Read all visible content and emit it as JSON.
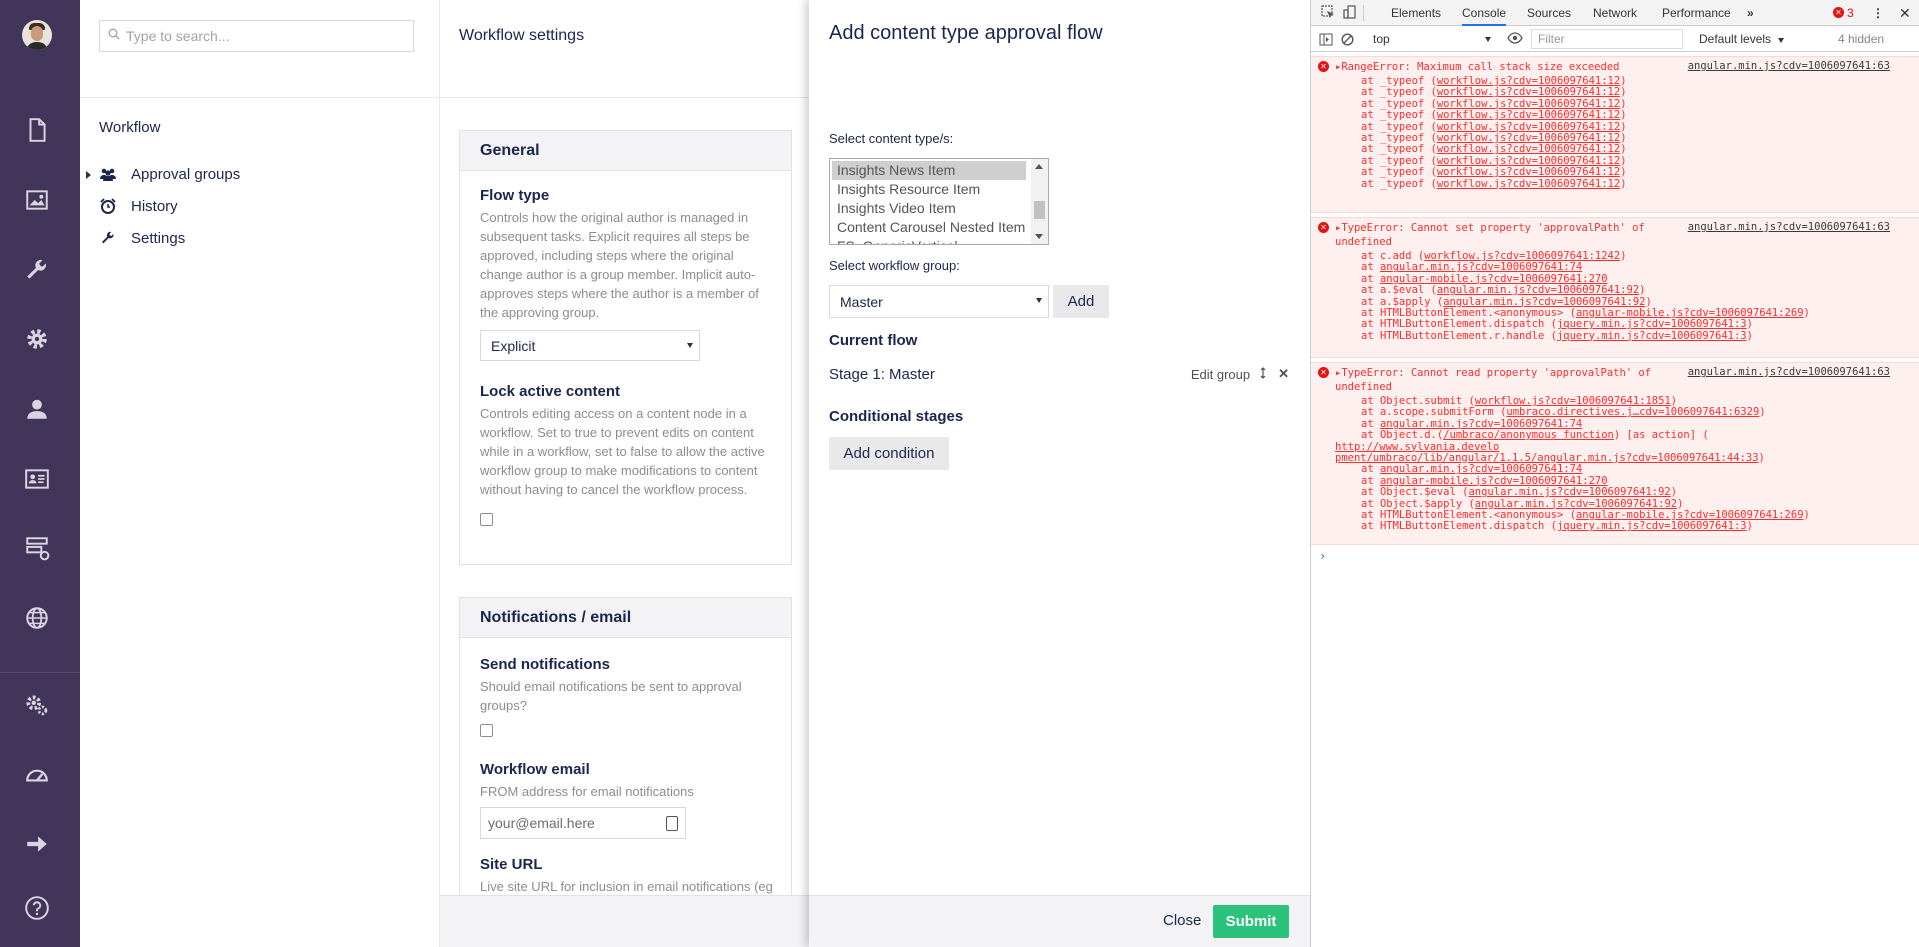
{
  "search": {
    "placeholder": "Type to search..."
  },
  "tree": {
    "title": "Workflow",
    "items": [
      {
        "label": "Approval groups",
        "icon": "users-icon"
      },
      {
        "label": "History",
        "icon": "alarm-clock-icon"
      },
      {
        "label": "Settings",
        "icon": "wrench-icon"
      }
    ]
  },
  "settings": {
    "title": "Workflow settings",
    "general": {
      "heading": "General",
      "flow_type_label": "Flow type",
      "flow_type_desc": "Controls how the original author is managed in subsequent tasks. Explicit requires all steps be approved, including steps where the original change author is a group member. Implicit auto-approves steps where the author is a member of the approving group.",
      "flow_type_value": "Explicit",
      "lock_label": "Lock active content",
      "lock_desc": "Controls editing access on a content node in a workflow. Set to true to prevent edits on content while in a workflow, set to false to allow the active workflow group to make modifications to content without having to cancel the workflow process."
    },
    "notifications": {
      "heading": "Notifications / email",
      "send_label": "Send notifications",
      "send_desc": "Should email notifications be sent to approval groups?",
      "email_label": "Workflow email",
      "email_desc": "FROM address for email notifications",
      "email_value": "your@email.here",
      "site_url_label": "Site URL",
      "site_url_desc": "Live site URL for inclusion in email notifications (eg"
    }
  },
  "dialog": {
    "title": "Add content type approval flow",
    "content_types_label": "Select content type/s:",
    "content_types": [
      "Insights News Item",
      "Insights Resource Item",
      "Insights Video Item",
      "Content Carousel Nested Item",
      "FS_GenericVertical"
    ],
    "workflow_group_label": "Select workflow group:",
    "workflow_group_value": "Master",
    "add_label": "Add",
    "current_flow_heading": "Current flow",
    "stage_label": "Stage 1: Master",
    "edit_group_label": "Edit group",
    "conditional_heading": "Conditional stages",
    "add_condition_label": "Add condition",
    "close_label": "Close",
    "submit_label": "Submit"
  },
  "devtools": {
    "tabs": [
      "Elements",
      "Console",
      "Sources",
      "Network",
      "Performance"
    ],
    "more_tabs": "»",
    "error_count": "3",
    "context": "top",
    "filter_placeholder": "Filter",
    "levels": "Default levels",
    "hidden": "4 hidden",
    "errors": [
      {
        "message": "RangeError: Maximum call stack size exceeded",
        "source": "angular.min.js?cdv=1006097641:63",
        "stack": [
          [
            "at _typeof (",
            "workflow.js?cdv=1006097641:12",
            ")"
          ],
          [
            "at _typeof (",
            "workflow.js?cdv=1006097641:12",
            ")"
          ],
          [
            "at _typeof (",
            "workflow.js?cdv=1006097641:12",
            ")"
          ],
          [
            "at _typeof (",
            "workflow.js?cdv=1006097641:12",
            ")"
          ],
          [
            "at _typeof (",
            "workflow.js?cdv=1006097641:12",
            ")"
          ],
          [
            "at _typeof (",
            "workflow.js?cdv=1006097641:12",
            ")"
          ],
          [
            "at _typeof (",
            "workflow.js?cdv=1006097641:12",
            ")"
          ],
          [
            "at _typeof (",
            "workflow.js?cdv=1006097641:12",
            ")"
          ],
          [
            "at _typeof (",
            "workflow.js?cdv=1006097641:12",
            ")"
          ],
          [
            "at _typeof (",
            "workflow.js?cdv=1006097641:12",
            ")"
          ]
        ]
      },
      {
        "message": "TypeError: Cannot set property 'approvalPath' of",
        "message2": "undefined",
        "source": "angular.min.js?cdv=1006097641:63",
        "stack": [
          [
            "at c.add (",
            "workflow.js?cdv=1006097641:1242",
            ")"
          ],
          [
            "at ",
            "angular.min.js?cdv=1006097641:74",
            ""
          ],
          [
            "at ",
            "angular-mobile.js?cdv=1006097641:270",
            ""
          ],
          [
            "at a.$eval (",
            "angular.min.js?cdv=1006097641:92",
            ")"
          ],
          [
            "at a.$apply (",
            "angular.min.js?cdv=1006097641:92",
            ")"
          ],
          [
            "at HTMLButtonElement.<anonymous> (",
            "angular-mobile.js?cdv=1006097641:269",
            ")"
          ],
          [
            "at HTMLButtonElement.dispatch (",
            "jquery.min.js?cdv=1006097641:3",
            ")"
          ],
          [
            "at HTMLButtonElement.r.handle (",
            "jquery.min.js?cdv=1006097641:3",
            ")"
          ]
        ]
      },
      {
        "message": "TypeError: Cannot read property 'approvalPath' of",
        "message2": "undefined",
        "source": "angular.min.js?cdv=1006097641:63",
        "stack": [
          [
            "at Object.submit (",
            "workflow.js?cdv=1006097641:1851",
            ")"
          ],
          [
            "at a.scope.submitForm (",
            "umbraco.directives.j…cdv=1006097641:6329",
            ")"
          ],
          [
            "at ",
            "angular.min.js?cdv=1006097641:74",
            ""
          ],
          [
            "at Object.d.(",
            "/umbraco/anonymous function",
            ") [as action] ("
          ],
          [
            "",
            "http://www.sylvania.develo",
            ""
          ],
          [
            "",
            "pment/umbraco/lib/angular/1.1.5/angular.min.js?cdv=1006097641:44:33",
            ")"
          ],
          [
            "at ",
            "angular.min.js?cdv=1006097641:74",
            ""
          ],
          [
            "at ",
            "angular-mobile.js?cdv=1006097641:270",
            ""
          ],
          [
            "at Object.$eval (",
            "angular.min.js?cdv=1006097641:92",
            ")"
          ],
          [
            "at Object.$apply (",
            "angular.min.js?cdv=1006097641:92",
            ")"
          ],
          [
            "at HTMLButtonElement.<anonymous> (",
            "angular-mobile.js?cdv=1006097641:269",
            ")"
          ],
          [
            "at HTMLButtonElement.dispatch (",
            "jquery.min.js?cdv=1006097641:3",
            ")"
          ]
        ]
      }
    ],
    "prompt": "›"
  },
  "colors": {
    "appbar": "#413659",
    "submit": "#2bc37c",
    "error": "#fe2e2e"
  }
}
